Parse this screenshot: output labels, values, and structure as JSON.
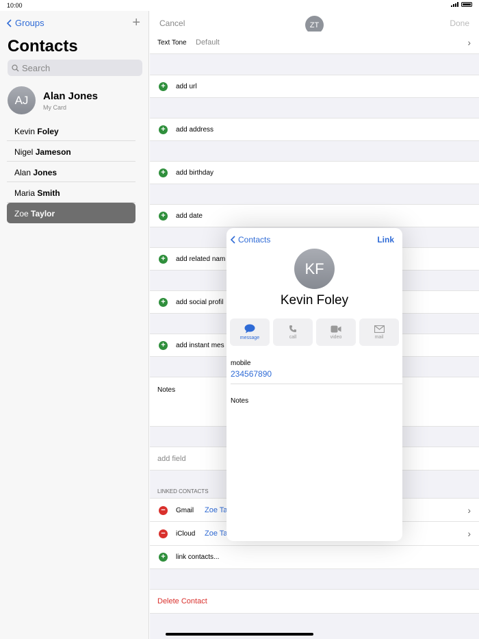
{
  "status": {
    "time": "10:00"
  },
  "sidebar": {
    "back_label": "Groups",
    "add_glyph": "+",
    "title": "Contacts",
    "search_placeholder": "Search",
    "my_card": {
      "initials": "AJ",
      "name": "Alan Jones",
      "subtitle": "My Card"
    },
    "contacts": [
      {
        "first": "Kevin",
        "last": "Foley",
        "selected": false
      },
      {
        "first": "Nigel",
        "last": "Jameson",
        "selected": false
      },
      {
        "first": "Alan",
        "last": "Jones",
        "selected": false
      },
      {
        "first": "Maria",
        "last": "Smith",
        "selected": false
      },
      {
        "first": "Zoe",
        "last": "Taylor",
        "selected": true
      }
    ]
  },
  "detail": {
    "cancel_label": "Cancel",
    "done_label": "Done",
    "avatar_initials": "ZT",
    "text_tone": {
      "label": "Text Tone",
      "value": "Default"
    },
    "add_rows": {
      "url": "add url",
      "address": "add address",
      "birthday": "add birthday",
      "date": "add date",
      "related": "add related nam",
      "social": "add social profil",
      "im": "add instant mes"
    },
    "notes_label": "Notes",
    "add_field_label": "add field",
    "linked_header": "LINKED CONTACTS",
    "linked": [
      {
        "source": "Gmail",
        "name": "Zoe Ta"
      },
      {
        "source": "iCloud",
        "name": "Zoe Ta"
      }
    ],
    "link_contacts_label": "link contacts...",
    "delete_label": "Delete Contact"
  },
  "popover": {
    "back_label": "Contacts",
    "link_label": "Link",
    "initials": "KF",
    "name": "Kevin Foley",
    "actions": {
      "message": "message",
      "call": "call",
      "video": "video",
      "mail": "mail"
    },
    "mobile_label": "mobile",
    "mobile_value": "234567890",
    "notes_label": "Notes"
  },
  "colors": {
    "accent": "#2f6bd6",
    "add_green": "#2f8f3c",
    "delete_red": "#d9302c",
    "selected_row": "#6e6e6e"
  }
}
